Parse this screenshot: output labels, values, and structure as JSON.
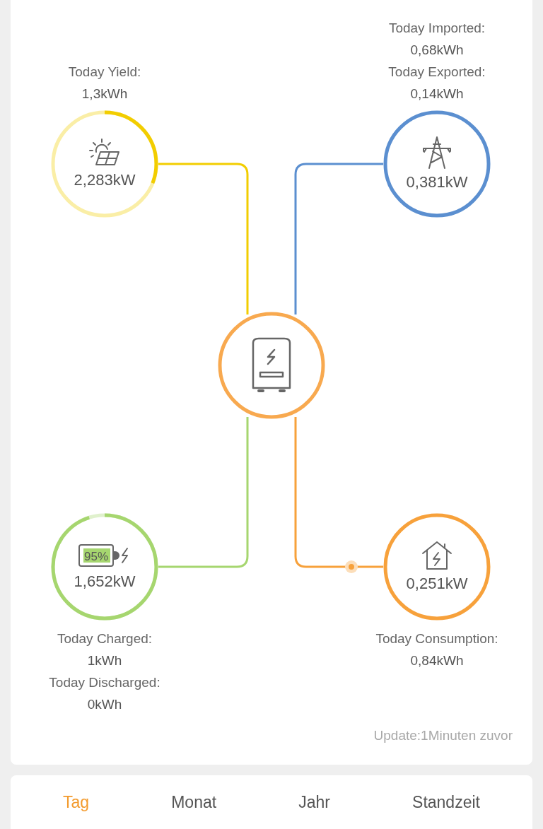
{
  "nodes": [
    {
      "kind": "solar",
      "value": "2,283kW",
      "color": "#f2cd00",
      "level": 0.31,
      "stats": [
        "Today Yield:",
        "1,3kWh"
      ]
    },
    {
      "kind": "grid",
      "value": "0,381kW",
      "color": "#5b8fd0",
      "stats": [
        "Today Imported:",
        "0,68kWh",
        "Today Exported:",
        "0,14kWh"
      ]
    },
    {
      "kind": "battery",
      "value": "1,652kW",
      "color": "#a6d66f",
      "level": 0.95,
      "soc": "95%",
      "stats": [
        "Today Charged:",
        "1kWh",
        "Today Discharged:",
        "0kWh"
      ]
    },
    {
      "kind": "home",
      "value": "0,251kW",
      "color": "#f7a13b",
      "stats": [
        "Today Consumption:",
        "0,84kWh"
      ]
    }
  ],
  "inverter": {
    "color": "#f8a94f"
  },
  "update": "Update:1Minuten zuvor",
  "tabs": [
    {
      "label": "Tag",
      "selected": true
    },
    {
      "label": "Monat",
      "selected": false
    },
    {
      "label": "Jahr",
      "selected": false
    },
    {
      "label": "Standzeit",
      "selected": false
    }
  ]
}
